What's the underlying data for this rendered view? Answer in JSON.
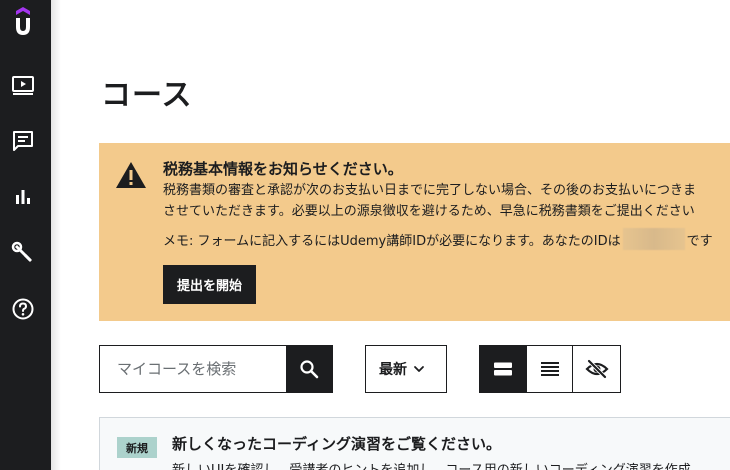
{
  "sidebar": {
    "logo_letter": "U",
    "items": [
      {
        "icon": "video-icon"
      },
      {
        "icon": "chat-icon"
      },
      {
        "icon": "bar-chart-icon"
      },
      {
        "icon": "tools-icon"
      },
      {
        "icon": "help-icon"
      }
    ],
    "brand_color": "#a435f0"
  },
  "page": {
    "title": "コース"
  },
  "alert": {
    "title": "税務基本情報をお知らせください。",
    "body_line1": "税務書類の審査と承認が次のお支払い日までに完了しない場合、その後のお支払いにつきま",
    "body_line2": "させていただきます。必要以上の源泉徴収を避けるため、早急に税務書類をご提出ください",
    "note_prefix": "メモ: フォームに記入するにはUdemy講師IDが必要になります。あなたのIDは",
    "note_suffix": "です",
    "button_label": "提出を開始",
    "background": "#f3ca8c"
  },
  "toolbar": {
    "search_placeholder": "マイコースを検索",
    "search_value": "",
    "sort_label": "最新",
    "views": [
      {
        "icon": "card-view-icon",
        "active": true
      },
      {
        "icon": "list-view-icon",
        "active": false
      },
      {
        "icon": "hide-icon",
        "active": false
      }
    ]
  },
  "card": {
    "badge": "新規",
    "title": "新しくなったコーディング演習をご覧ください。",
    "body": "新しいUIを確認し、受講者のヒントを追加し、コース用の新しいコーディング演習を作成"
  }
}
